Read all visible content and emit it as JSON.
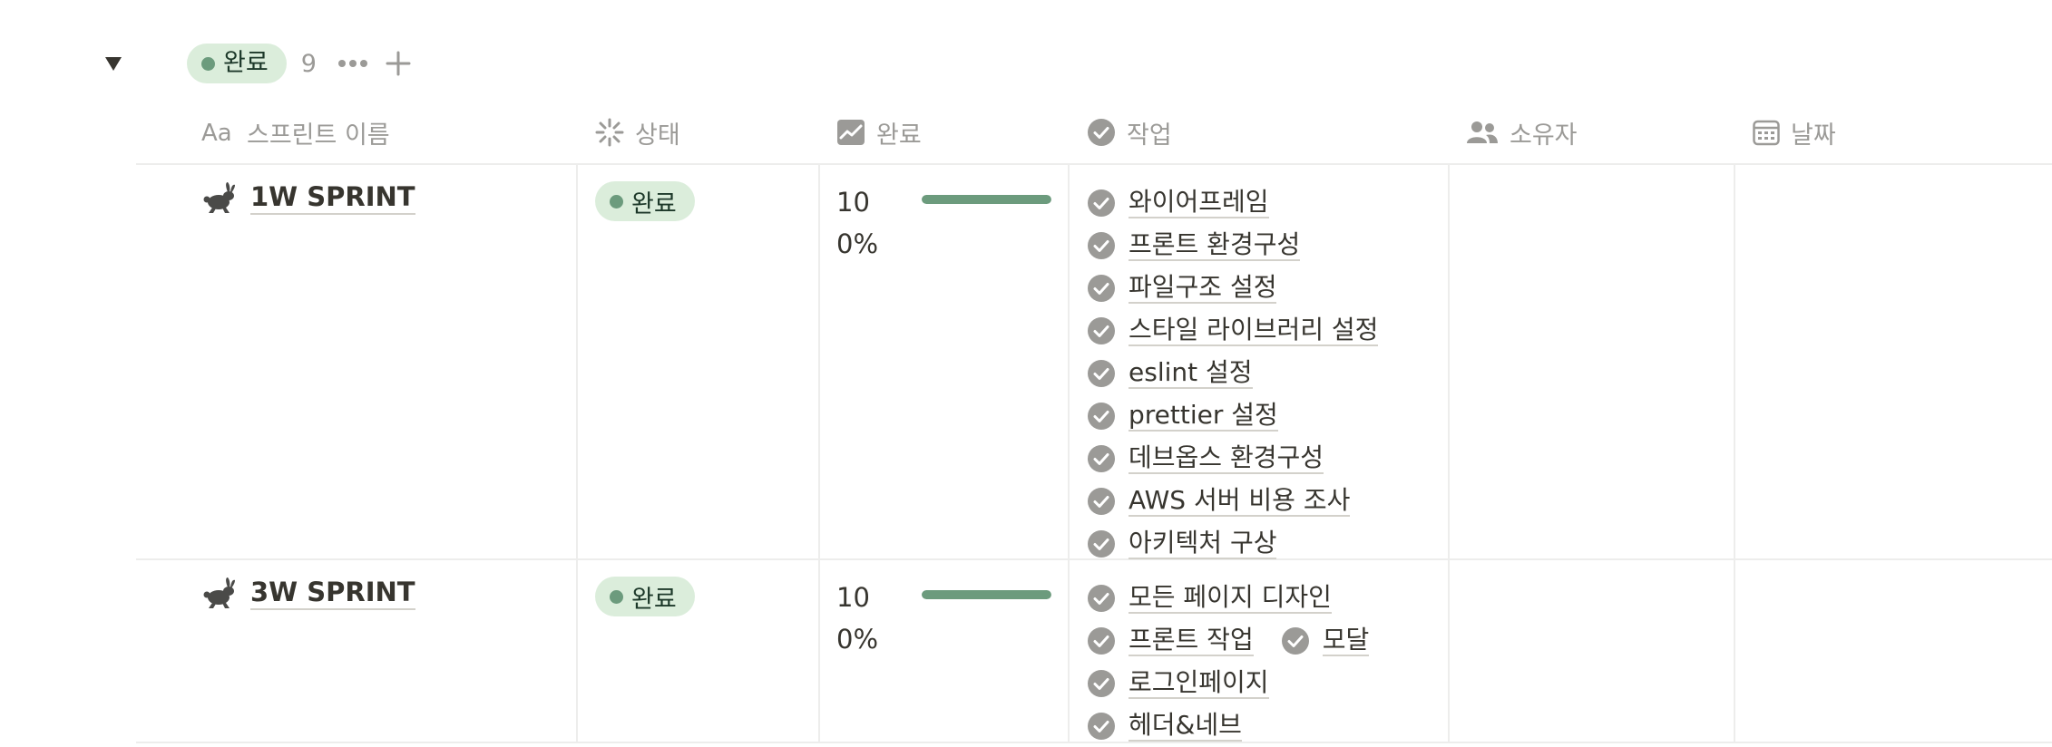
{
  "group": {
    "status_label": "완료",
    "count": "9",
    "colors": {
      "pill_bg": "#dbeddb",
      "dot": "#6c9b7d"
    },
    "icons": [
      "caret-down-icon",
      "more-dots-icon",
      "plus-icon"
    ]
  },
  "columns": [
    {
      "label": "스프린트 이름",
      "icon": "title-aa-icon"
    },
    {
      "label": "상태",
      "icon": "status-spinner-icon"
    },
    {
      "label": "완료",
      "icon": "chart-icon"
    },
    {
      "label": "작업",
      "icon": "check-circle-icon"
    },
    {
      "label": "소유자",
      "icon": "people-icon"
    },
    {
      "label": "날짜",
      "icon": "calendar-icon"
    }
  ],
  "rows": [
    {
      "title": "1W SPRINT",
      "icon": "rabbit-icon",
      "status": "완료",
      "progress": {
        "value": 100,
        "label": "100%"
      },
      "tasks": [
        [
          "와이어프레임"
        ],
        [
          "프론트 환경구성"
        ],
        [
          "파일구조 설정"
        ],
        [
          "스타일 라이브러리 설정"
        ],
        [
          "eslint 설정"
        ],
        [
          "prettier 설정"
        ],
        [
          "데브옵스 환경구성"
        ],
        [
          "AWS 서버 비용 조사"
        ],
        [
          "아키텍처 구상"
        ]
      ],
      "owner": "",
      "date": ""
    },
    {
      "title": "3W SPRINT",
      "icon": "rabbit-icon",
      "status": "완료",
      "progress": {
        "value": 100,
        "label": "100%"
      },
      "tasks": [
        [
          "모든 페이지 디자인"
        ],
        [
          "프론트 작업",
          "모달"
        ],
        [
          "로그인페이지"
        ],
        [
          "헤더&네브"
        ]
      ],
      "owner": "",
      "date": ""
    }
  ]
}
